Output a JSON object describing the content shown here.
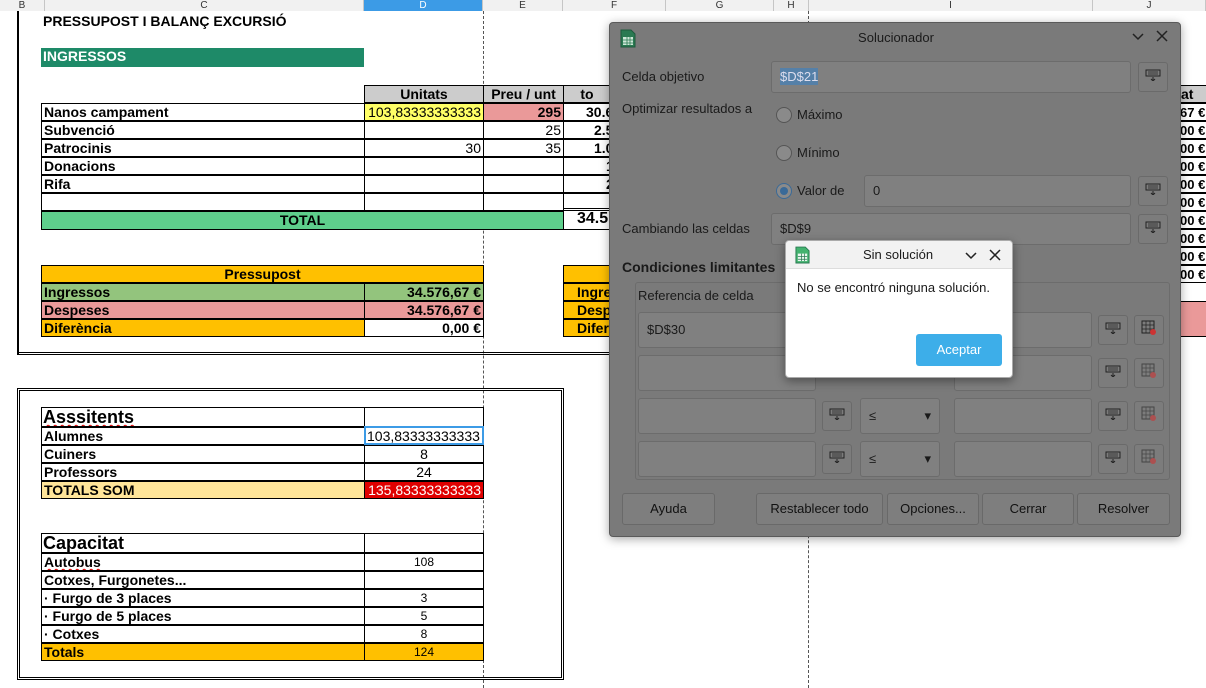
{
  "columns": [
    "B",
    "C",
    "D",
    "E",
    "F",
    "G",
    "H",
    "I",
    "J"
  ],
  "sheet": {
    "title": "PRESSUPOST I BALANÇ EXCURSIÓ",
    "ingressos_label": "INGRESSOS",
    "table1": {
      "headers": [
        "Unitats",
        "Preu / unt",
        "to"
      ],
      "rows": [
        {
          "label": "Nanos campament",
          "units": "103,83333333333",
          "price": "295",
          "total": "30.6"
        },
        {
          "label": "Subvenció",
          "units": "",
          "price": "25",
          "total": "2.5"
        },
        {
          "label": "Patrocinis",
          "units": "30",
          "price": "35",
          "total": "1.0"
        },
        {
          "label": "Donacions",
          "units": "",
          "price": "",
          "total": "1"
        },
        {
          "label": "Rifa",
          "units": "",
          "price": "",
          "total": "2"
        },
        {
          "label": "",
          "units": "",
          "price": "",
          "total": ""
        }
      ],
      "total_label": "TOTAL",
      "total_value": "34.5"
    },
    "pressupost": {
      "header": "Pressupost",
      "rows": [
        {
          "label": "Ingressos",
          "value": "34.576,67 €"
        },
        {
          "label": "Despeses",
          "value": "34.576,67 €"
        },
        {
          "label": "Diferència",
          "value": "0,00 €"
        }
      ],
      "partial_labels": [
        "Ingre",
        "Desp",
        "Difer"
      ]
    },
    "assistents": {
      "header": "Asssitents",
      "rows": [
        {
          "label": "Alumnes",
          "value": "103,83333333333"
        },
        {
          "label": "Cuiners",
          "value": "8"
        },
        {
          "label": "Professors",
          "value": "24"
        }
      ],
      "total_label": "TOTALS SOM",
      "total_value": "135,83333333333"
    },
    "capacitat": {
      "header": "Capacitat",
      "rows": [
        {
          "label": "Autobus",
          "value": "108"
        },
        {
          "label": "Cotxes, Furgonetes...",
          "value": ""
        },
        {
          "label": "· Furgo de 3 places",
          "value": "3"
        },
        {
          "label": "· Furgo de 5 places",
          "value": "5"
        },
        {
          "label": "· Cotxes",
          "value": "8"
        }
      ],
      "total_label": "Totals",
      "total_value": "124"
    },
    "right_partial": {
      "header": "at",
      "values": [
        "67 €",
        "00 €",
        "00 €",
        "00 €",
        "00 €",
        "00 €",
        "00 €",
        "00 €",
        "00 €",
        "00 €"
      ]
    }
  },
  "solver": {
    "title": "Solucionador",
    "target_label": "Celda objetivo",
    "target_value": "$D$21",
    "optimize_label": "Optimizar resultados a",
    "opt_max": "Máximo",
    "opt_min": "Mínimo",
    "opt_value": "Valor de",
    "value_of": "0",
    "changing_label": "Cambiando las celdas",
    "changing_value": "$D$9",
    "constraints_label": "Condiciones limitantes",
    "cell_ref_label": "Referencia de celda",
    "constraint_rows": [
      {
        "ref": "$D$30",
        "op": "≤",
        "value": ""
      },
      {
        "ref": "",
        "op": "≤",
        "value": ""
      },
      {
        "ref": "",
        "op": "≤",
        "value": ""
      },
      {
        "ref": "",
        "op": "≤",
        "value": ""
      }
    ],
    "buttons": {
      "help": "Ayuda",
      "reset": "Restablecer todo",
      "options": "Opciones...",
      "close": "Cerrar",
      "solve": "Resolver"
    }
  },
  "popup": {
    "title": "Sin solución",
    "message": "No se encontró ninguna solución.",
    "ok": "Aceptar"
  },
  "colors": {
    "accent": "#3daee9",
    "header_green": "#1e8a68",
    "total_green": "#5ecf8c",
    "orange": "#ffc000",
    "red": "#e00000"
  }
}
